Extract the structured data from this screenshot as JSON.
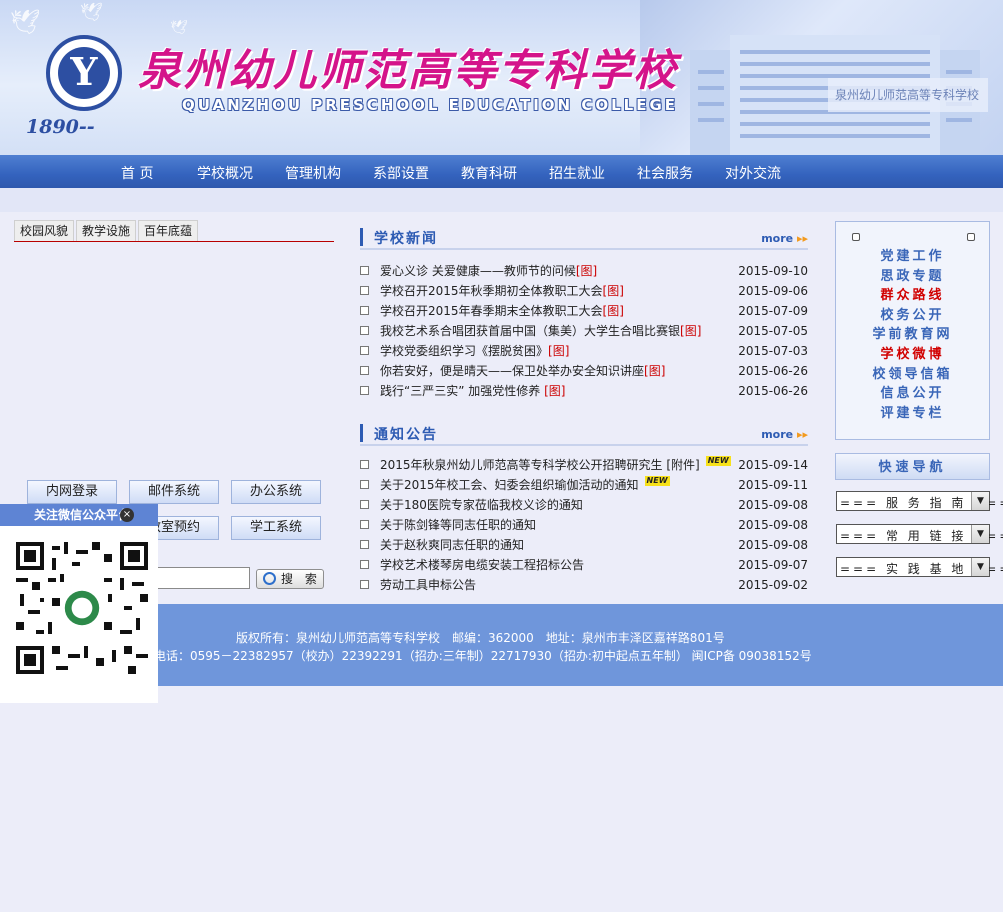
{
  "header": {
    "school_name_cn": "泉州幼儿师范高等专科学校",
    "school_name_en": "QUANZHOU PRESCHOOL EDUCATION COLLEGE",
    "founded": "1890--",
    "building_sign": "泉州幼儿师范高等专科学校"
  },
  "nav": [
    "首 页",
    "学校概况",
    "管理机构",
    "系部设置",
    "教育科研",
    "招生就业",
    "社会服务",
    "对外交流"
  ],
  "left": {
    "tabs": [
      "校园风貌",
      "教学设施",
      "百年底蕴"
    ],
    "systems": [
      "内网登录",
      "邮件系统",
      "办公系统",
      "教室预约",
      "学工系统"
    ],
    "search_button": "搜 索"
  },
  "wechat": {
    "title": "关注微信公众平台"
  },
  "news": {
    "title": "学校新闻",
    "more": "more",
    "items": [
      {
        "text": "爱心义诊 关爱健康——教师节的问候",
        "img": "[图]",
        "date": "2015-09-10"
      },
      {
        "text": "学校召开2015年秋季期初全体教职工大会",
        "img": "[图]",
        "date": "2015-09-06"
      },
      {
        "text": "学校召开2015年春季期末全体教职工大会",
        "img": "[图]",
        "date": "2015-07-09"
      },
      {
        "text": "我校艺术系合唱团获首届中国（集美）大学生合唱比赛银",
        "img": "[图]",
        "date": "2015-07-05"
      },
      {
        "text": "学校党委组织学习《摆脱贫困》",
        "img": "[图]",
        "date": "2015-07-03"
      },
      {
        "text": "你若安好，便是晴天——保卫处举办安全知识讲座",
        "img": "[图]",
        "date": "2015-06-26"
      },
      {
        "text": "践行“三严三实” 加强党性修养 ",
        "img": "[图]",
        "date": "2015-06-26"
      }
    ]
  },
  "notices": {
    "title": "通知公告",
    "more": "more",
    "new_label": "NEW",
    "items": [
      {
        "text": "2015年秋泉州幼儿师范高等专科学校公开招聘研究生 [附件]",
        "new": true,
        "date": "2015-09-14"
      },
      {
        "text": "关于2015年校工会、妇委会组织瑜伽活动的通知",
        "new": true,
        "date": "2015-09-11"
      },
      {
        "text": "关于180医院专家莅临我校义诊的通知",
        "new": false,
        "date": "2015-09-08"
      },
      {
        "text": "关于陈剑锋等同志任职的通知",
        "new": false,
        "date": "2015-09-08"
      },
      {
        "text": "关于赵秋爽同志任职的通知",
        "new": false,
        "date": "2015-09-08"
      },
      {
        "text": "学校艺术楼琴房电缆安装工程招标公告",
        "new": false,
        "date": "2015-09-07"
      },
      {
        "text": "劳动工具申标公告",
        "new": false,
        "date": "2015-09-02"
      }
    ]
  },
  "right": {
    "links": [
      {
        "text": "党建工作",
        "red": false
      },
      {
        "text": "思政专题",
        "red": false
      },
      {
        "text": "群众路线",
        "red": true
      },
      {
        "text": "校务公开",
        "red": false
      },
      {
        "text": "学前教育网",
        "red": false
      },
      {
        "text": "学校微博",
        "red": true
      },
      {
        "text": "校领导信箱",
        "red": false
      },
      {
        "text": "信息公开",
        "red": false
      },
      {
        "text": "评建专栏",
        "red": false
      }
    ],
    "quick_nav": "快速导航",
    "selects": [
      "=== 服 务 指 南 ===",
      "=== 常 用 链 接 ===",
      "=== 实 践 基 地 ==="
    ]
  },
  "footer": {
    "line1": "版权所有：泉州幼儿师范高等专科学校　邮编：362000　地址：泉州市丰泽区嘉祥路801号",
    "line2": "电话：0595－22382957（校办）22392291（招办:三年制）22717930（招办:初中起点五年制） 闽ICP备 09038152号"
  },
  "colors": {
    "nav_blue": "#3463be",
    "link_blue": "#3a66b8",
    "accent_red": "#d10000",
    "footer_blue": "#6f96db"
  }
}
